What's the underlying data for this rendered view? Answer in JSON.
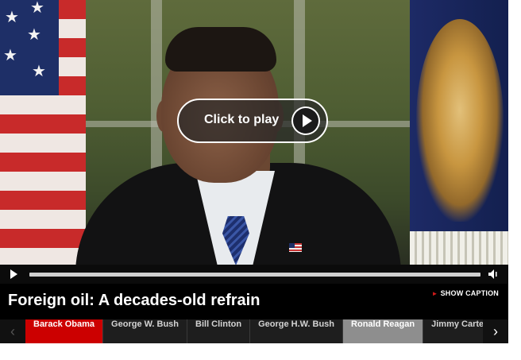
{
  "video": {
    "play_overlay_label": "Click to play"
  },
  "caption": {
    "title": "Foreign oil: A decades-old refrain",
    "show_caption_label": "SHOW CAPTION"
  },
  "nav": {
    "items": [
      {
        "label": "Barack Obama",
        "state": "active"
      },
      {
        "label": "George W. Bush",
        "state": "normal"
      },
      {
        "label": "Bill Clinton",
        "state": "normal"
      },
      {
        "label": "George H.W. Bush",
        "state": "normal"
      },
      {
        "label": "Ronald Reagan",
        "state": "selected"
      },
      {
        "label": "Jimmy Carter",
        "state": "normal"
      }
    ],
    "prev_icon": "chevron-left-icon",
    "next_icon": "chevron-right-icon"
  },
  "colors": {
    "active_tab": "#cc0000",
    "selected_tab": "#8e8e8e",
    "accent_arrow": "#d11a1a"
  }
}
